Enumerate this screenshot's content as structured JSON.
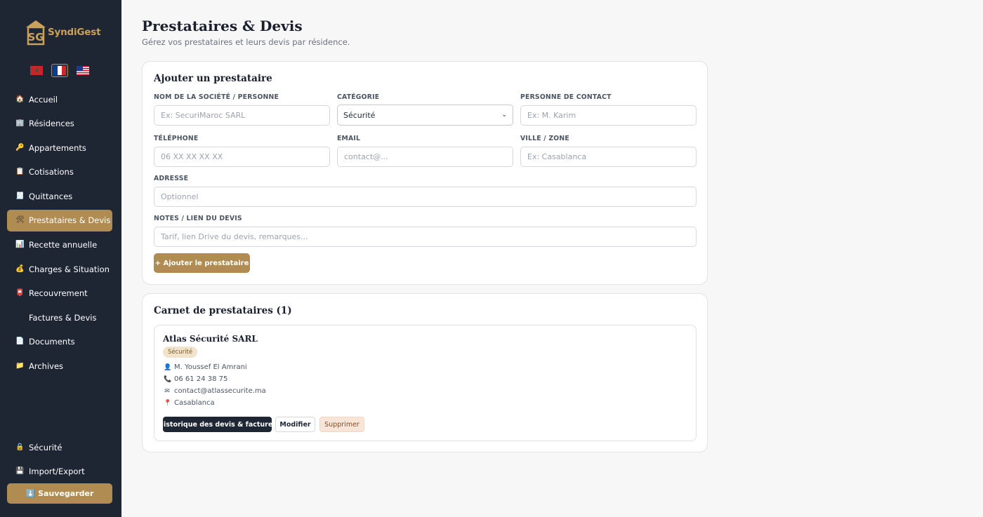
{
  "app": {
    "name": "SyndiGest",
    "languages": [
      {
        "code": "ma",
        "icon": "morocco-flag-icon",
        "active": false
      },
      {
        "code": "fr",
        "icon": "france-flag-icon",
        "active": true
      },
      {
        "code": "us",
        "icon": "usa-flag-icon",
        "active": false
      }
    ]
  },
  "sidebar": {
    "items": [
      {
        "label": "Accueil",
        "icon": "🏠"
      },
      {
        "label": "Résidences",
        "icon": "🏢"
      },
      {
        "label": "Appartements",
        "icon": "🔑"
      },
      {
        "label": "Cotisations",
        "icon": "📋"
      },
      {
        "label": "Quittances",
        "icon": "🧾"
      },
      {
        "label": "Prestataires & Devis",
        "icon": "🛠"
      },
      {
        "label": "Recette annuelle",
        "icon": "📊"
      },
      {
        "label": "Charges & Situation",
        "icon": "💰"
      },
      {
        "label": "Recouvrement",
        "icon": "📮"
      },
      {
        "label": "Factures & Devis",
        "icon": "🖇"
      },
      {
        "label": "Documents",
        "icon": "📄"
      },
      {
        "label": "Archives",
        "icon": "📁"
      }
    ],
    "active_index": 5,
    "bottom": [
      {
        "label": "Sécurité",
        "icon": "🔒"
      },
      {
        "label": "Import/Export",
        "icon": "💾"
      }
    ],
    "save_label": "⬇️ Sauvegarder"
  },
  "header": {
    "title": "Prestataires & Devis",
    "subtitle": "Gérez vos prestataires et leurs devis par résidence."
  },
  "form": {
    "title": "Ajouter un prestataire",
    "company": {
      "label": "NOM DE LA SOCIÉTÉ / PERSONNE",
      "placeholder": "Ex: SecuriMaroc SARL",
      "value": ""
    },
    "category": {
      "label": "CATÉGORIE",
      "value": "Sécurité"
    },
    "contact": {
      "label": "PERSONNE DE CONTACT",
      "placeholder": "Ex: M. Karim",
      "value": ""
    },
    "phone": {
      "label": "TÉLÉPHONE",
      "placeholder": "06 XX XX XX XX",
      "value": ""
    },
    "email": {
      "label": "EMAIL",
      "placeholder": "contact@...",
      "value": ""
    },
    "city": {
      "label": "VILLE / ZONE",
      "placeholder": "Ex: Casablanca",
      "value": ""
    },
    "address": {
      "label": "ADRESSE",
      "placeholder": "Optionnel",
      "value": ""
    },
    "notes": {
      "label": "NOTES / LIEN DU DEVIS",
      "placeholder": "Tarif, lien Drive du devis, remarques...",
      "value": ""
    },
    "submit_label": "+ Ajouter le prestataire"
  },
  "directory": {
    "title": "Carnet de prestataires (1)",
    "providers": [
      {
        "name": "Atlas Sécurité SARL",
        "category": "Sécurité",
        "contact": "M. Youssef El Amrani",
        "phone": "06 61 24 38 75",
        "email": "contact@atlassecurite.ma",
        "city": "Casablanca",
        "icons": {
          "contact": "👤",
          "phone": "📞",
          "email": "✉",
          "city": "📍"
        },
        "history_label": "Historique des devis & factures",
        "edit_label": "Modifier",
        "delete_label": "Supprimer"
      }
    ]
  },
  "colors": {
    "sidebar_bg": "#1e2533",
    "accent": "#b08b52",
    "page_bg": "#f7f7f8"
  }
}
